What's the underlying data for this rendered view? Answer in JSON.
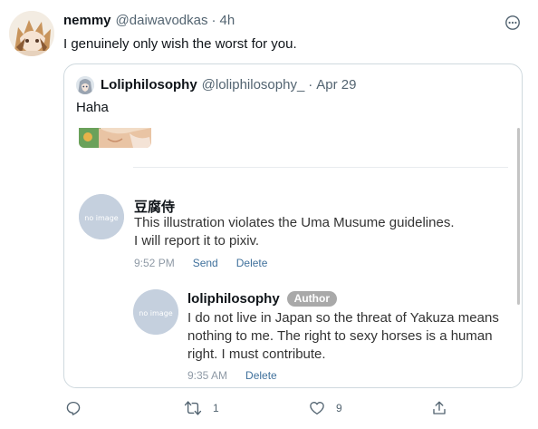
{
  "tweet": {
    "author_name": "nemmy",
    "author_handle": "@daiwavodkas",
    "separator": "·",
    "time": "4h",
    "text": "I genuinely only wish the worst for you.",
    "avatar_icon": "anime-character-avatar",
    "more_icon": "more-options-icon"
  },
  "quote": {
    "author_name": "Loliphilosophy",
    "author_handle": "@loliphilosophy_",
    "separator": "·",
    "date": "Apr 29",
    "text": "Haha",
    "avatar_icon": "anime-character-avatar"
  },
  "comments": [
    {
      "name": "豆腐侍",
      "lines": [
        "This illustration violates the Uma Musume guidelines.",
        "I will report it to pixiv."
      ],
      "time": "9:52 PM",
      "send_label": "Send",
      "delete_label": "Delete",
      "avatar_text": "no image"
    },
    {
      "name": "loliphilosophy",
      "badge": "Author",
      "lines": [
        "I do not live in Japan so the threat of Yakuza means",
        "nothing to me. The right to sexy horses is a human",
        "right. I must contribute."
      ],
      "time": "9:35 AM",
      "delete_label": "Delete",
      "avatar_text": "no image"
    }
  ],
  "actions": {
    "reply_icon": "reply-icon",
    "retweet_icon": "retweet-icon",
    "retweet_count": "1",
    "like_icon": "heart-icon",
    "like_count": "9",
    "share_icon": "share-icon"
  },
  "colors": {
    "primary_text": "#0f1419",
    "secondary_text": "#536471",
    "link": "#40719c",
    "badge_bg": "#a9a9a9",
    "border": "#cfd9de"
  }
}
